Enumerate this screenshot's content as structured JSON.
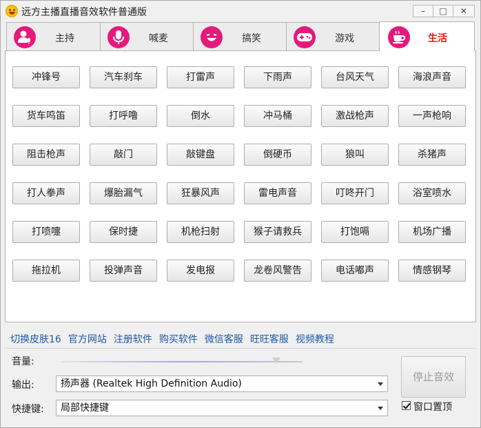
{
  "window": {
    "title": "远方主播直播音效软件普通版",
    "minimize": "–",
    "maximize": "□",
    "close": "✕"
  },
  "tabs": [
    {
      "label": "主持",
      "icon": "host-mic-icon"
    },
    {
      "label": "喊麦",
      "icon": "microphone-icon"
    },
    {
      "label": "搞笑",
      "icon": "laughing-face-icon"
    },
    {
      "label": "游戏",
      "icon": "gamepad-icon"
    },
    {
      "label": "生活",
      "icon": "coffee-cup-icon",
      "active": true
    }
  ],
  "sounds": [
    [
      "冲锋号",
      "汽车刹车",
      "打雷声",
      "下雨声",
      "台风天气",
      "海浪声音"
    ],
    [
      "货车鸣笛",
      "打呼噜",
      "倒水",
      "冲马桶",
      "激战枪声",
      "一声枪响"
    ],
    [
      "阻击枪声",
      "敲门",
      "敲键盘",
      "倒硬币",
      "狼叫",
      "杀猪声"
    ],
    [
      "打人拳声",
      "爆胎漏气",
      "狂暴风声",
      "雷电声音",
      "叮咚开门",
      "浴室喷水"
    ],
    [
      "打喷嚏",
      "保时捷",
      "机枪扫射",
      "猴子请救兵",
      "打饱嗝",
      "机场广播"
    ],
    [
      "拖拉机",
      "投弹声音",
      "发电报",
      "龙卷风警告",
      "电话嘟声",
      "情感钢琴"
    ]
  ],
  "links": [
    "切换皮肤16",
    "官方网站",
    "注册软件",
    "购买软件",
    "微信客服",
    "旺旺客服",
    "视频教程"
  ],
  "controls": {
    "volume_label": "音量:",
    "volume_level": 0.89,
    "output_label": "输出:",
    "output_value": "扬声器 (Realtek High Definition Audio)",
    "hotkey_label": "快捷键:",
    "hotkey_value": "局部快捷键",
    "stop_label": "停止音效",
    "ontop_label": "窗口置顶",
    "ontop_checked": true
  },
  "colors": {
    "accent": "#e5197c",
    "active_tab_text": "#e8160c",
    "link": "#1d5aa8"
  }
}
